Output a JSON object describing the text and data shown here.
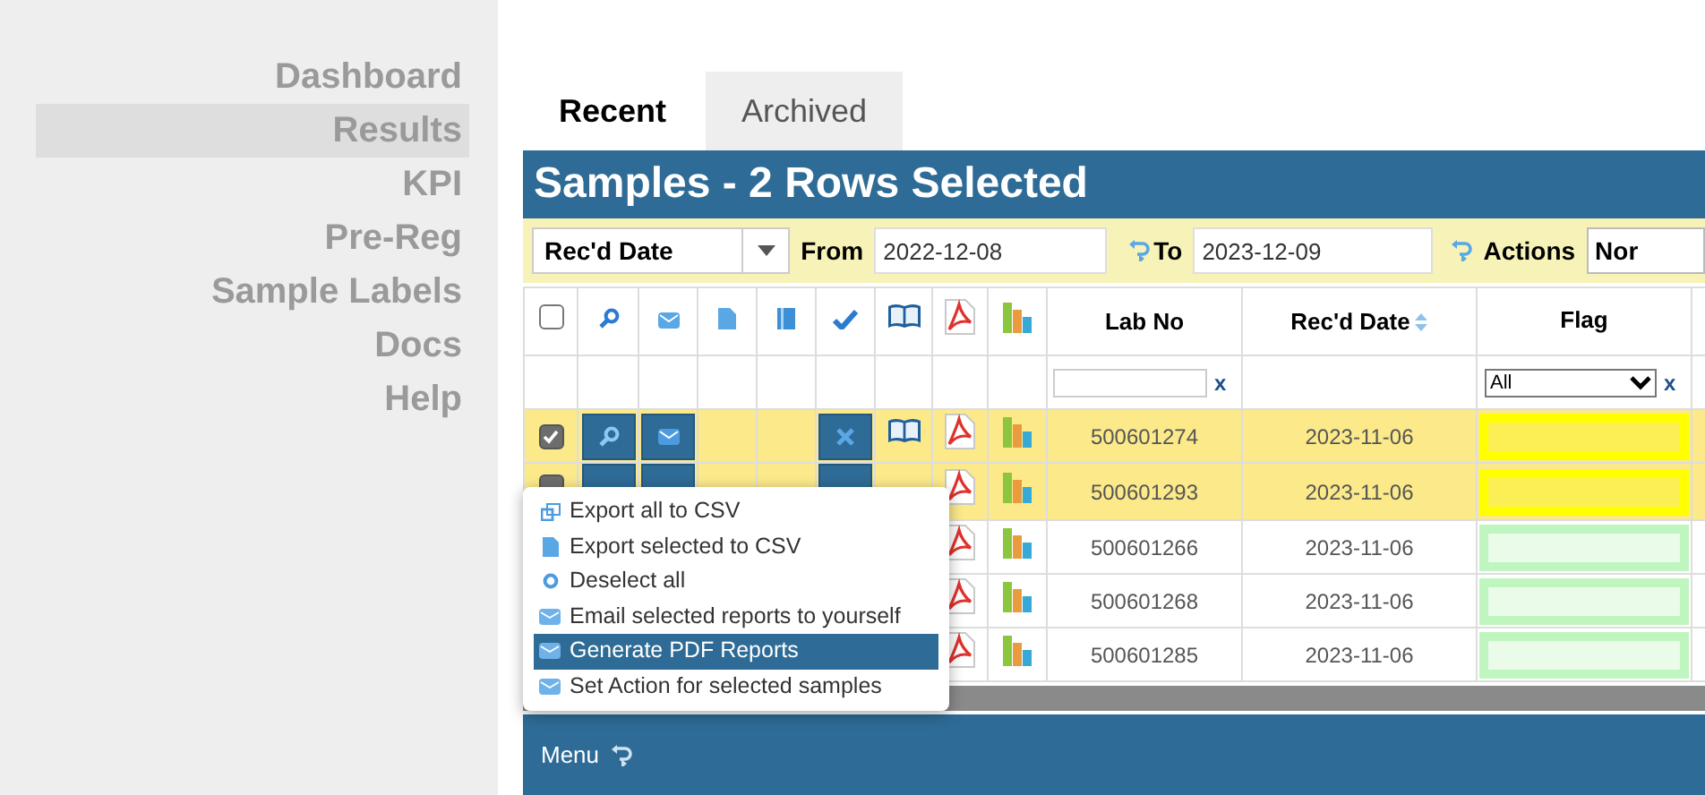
{
  "sidebar": {
    "items": [
      {
        "label": "Dashboard",
        "selected": false
      },
      {
        "label": "Results",
        "selected": true
      },
      {
        "label": "KPI",
        "selected": false
      },
      {
        "label": "Pre-Reg",
        "selected": false
      },
      {
        "label": "Sample Labels",
        "selected": false
      },
      {
        "label": "Docs",
        "selected": false
      },
      {
        "label": "Help",
        "selected": false
      }
    ]
  },
  "tabs": [
    {
      "label": "Recent",
      "selected": true
    },
    {
      "label": "Archived",
      "selected": false
    }
  ],
  "panel_title": "Samples - 2 Rows Selected",
  "filter_bar": {
    "field": "Rec'd Date",
    "from_label": "From",
    "from_value": "2022-12-08",
    "to_label": "To",
    "to_value": "2023-12-09",
    "actions_label": "Actions",
    "actions_value": "Nor"
  },
  "table": {
    "columns": [
      "Lab No",
      "Rec'd Date",
      "Flag"
    ],
    "lab_filter_clear": "x",
    "flag_filter": {
      "value": "All",
      "clear": "x"
    },
    "header_checkbox": {
      "checked": false
    },
    "rows": [
      {
        "selected": true,
        "lab_no": "500601274",
        "date": "2023-11-06",
        "color": "#ffff00"
      },
      {
        "selected": true,
        "lab_no": "500601293",
        "date": "2023-11-06",
        "color": "#ffff00"
      },
      {
        "selected": false,
        "lab_no": "500601266",
        "date": "2023-11-06",
        "color": "#bff5bf"
      },
      {
        "selected": false,
        "lab_no": "500601268",
        "date": "2023-11-06",
        "color": "#bff5bf"
      },
      {
        "selected": false,
        "lab_no": "500601285",
        "date": "2023-11-06",
        "color": "#bff5bf"
      }
    ]
  },
  "context_menu": {
    "items": [
      {
        "label": "Export all to CSV",
        "kind": "export",
        "selected": false
      },
      {
        "label": "Export selected to CSV",
        "kind": "file",
        "selected": false
      },
      {
        "label": "Deselect all",
        "kind": "circle",
        "selected": false
      },
      {
        "label": "Email selected reports to yourself",
        "kind": "mail",
        "selected": false
      },
      {
        "label": "Generate PDF Reports",
        "kind": "mail",
        "selected": true
      },
      {
        "label": "Set Action for selected samples",
        "kind": "mail",
        "selected": false
      }
    ]
  },
  "footer": {
    "label": "Menu"
  }
}
